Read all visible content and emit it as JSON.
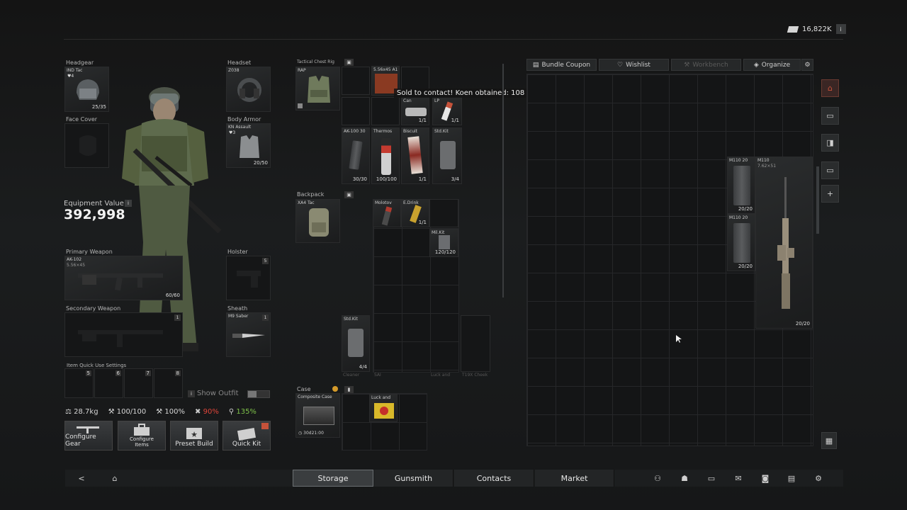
{
  "currency": {
    "amount": "16,822K",
    "info": "i"
  },
  "notification": "Sold to contact! Koen obtained: 108",
  "equipment": {
    "headgear": {
      "label": "Headgear",
      "name": "IND Tac",
      "armor": "4",
      "durability": "25/35"
    },
    "headset": {
      "label": "Headset",
      "name": "Z038"
    },
    "face_cover": {
      "label": "Face Cover"
    },
    "body_armor": {
      "label": "Body Armor",
      "name": "KN Assault",
      "armor": "3",
      "durability": "20/50"
    },
    "value_label": "Equipment Value",
    "value_info": "i",
    "value": "392,998",
    "primary": {
      "label": "Primary Weapon",
      "name": "AK-102",
      "caliber": "5.56×45",
      "ammo": "60/60"
    },
    "holster": {
      "label": "Holster",
      "key": "5"
    },
    "secondary": {
      "label": "Secondary Weapon",
      "key": "1"
    },
    "sheath": {
      "label": "Sheath",
      "name": "M9 Saber",
      "key": "1"
    },
    "quick_use_label": "Item Quick Use Settings",
    "quick_keys": [
      "5",
      "6",
      "7",
      "8"
    ],
    "show_outfit": "Show Outfit",
    "show_outfit_info": "i"
  },
  "stats": {
    "weight": "28.7kg",
    "durability": "100/100",
    "stat2": "100%",
    "stat3": "90%",
    "stat4": "135%"
  },
  "actions": [
    {
      "label": "Configure Gear"
    },
    {
      "label": "Configure Items"
    },
    {
      "label": "Preset Build"
    },
    {
      "label": "Quick Kit"
    }
  ],
  "rig": {
    "label": "Tactical Chest Rig",
    "name": "RAP",
    "items": {
      "ammo": {
        "name": "5.56x45 A1"
      },
      "can": {
        "name": "Can",
        "count": "1/1"
      },
      "lp": {
        "name": "LP",
        "count": "1/1"
      },
      "ak": {
        "name": "AK-100 30",
        "count": "30/30"
      },
      "thermos": {
        "name": "Thermos",
        "count": "100/100"
      },
      "biscuit": {
        "name": "Biscuit",
        "count": "1/1"
      },
      "stdkit": {
        "name": "Std.Kit",
        "count": "3/4"
      }
    }
  },
  "backpack": {
    "label": "Backpack",
    "name": "XA4 Tac",
    "items": {
      "molotov": {
        "name": "Molotov"
      },
      "edrink": {
        "name": "E.Drink",
        "count": "1/1"
      },
      "milkit": {
        "name": "Mil.Kit",
        "count": "120/120"
      },
      "stdkit2": {
        "name": "Std.Kit",
        "count": "4/4"
      }
    },
    "cut_labels": [
      "Cleaner",
      "SAI",
      "Luck and",
      "T19X Cheek"
    ]
  },
  "case": {
    "label": "Case",
    "name": "Composite Case",
    "timer": "30d21:00",
    "item": "Luck and"
  },
  "storage": {
    "buttons": [
      "Bundle Coupon",
      "Wishlist",
      "Workbench",
      "Organize"
    ],
    "items": {
      "m110mag1": {
        "name": "M110 20",
        "count": "20/20"
      },
      "m110mag2": {
        "name": "M110 20",
        "count": "20/20"
      },
      "m110": {
        "name": "M110",
        "caliber": "7.62×51",
        "count": "20/20"
      }
    }
  },
  "nav": {
    "tabs": [
      "Storage",
      "Gunsmith",
      "Contacts",
      "Market"
    ],
    "active": "Storage"
  },
  "colors": {
    "accent": "#c6523a",
    "warn": "#e0453a",
    "good": "#7fc24a"
  }
}
